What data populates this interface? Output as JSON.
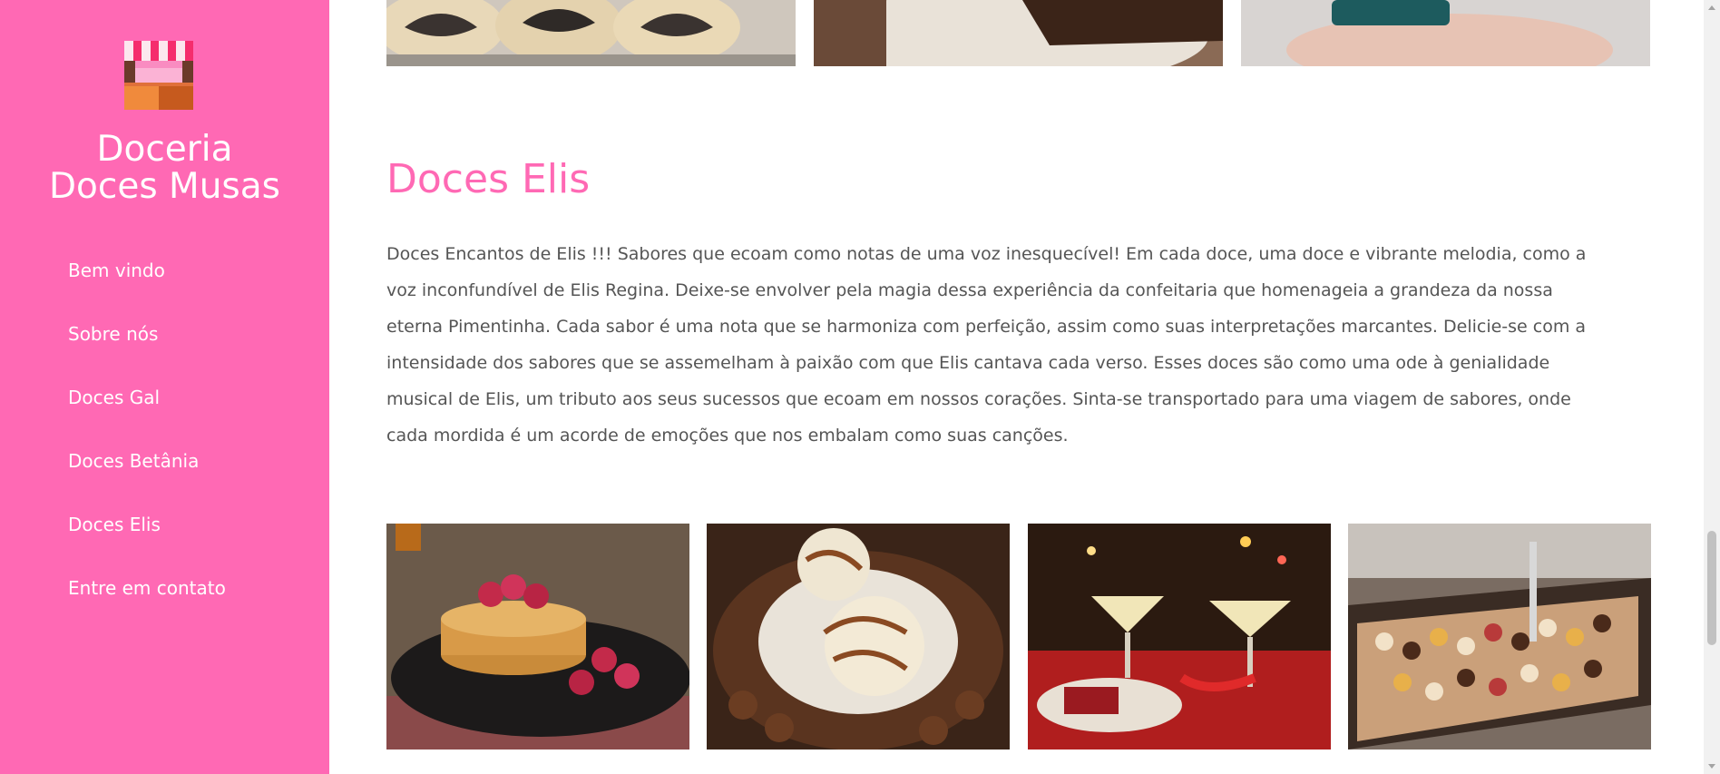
{
  "brand": {
    "title_line1": "Doceria",
    "title_line2": "Doces Musas",
    "logo_icon": "shop-awning-icon",
    "accent_color": "#ff69b4"
  },
  "nav": {
    "items": [
      {
        "label": "Bem vindo"
      },
      {
        "label": "Sobre nós"
      },
      {
        "label": "Doces Gal"
      },
      {
        "label": "Doces Betânia"
      },
      {
        "label": "Doces Elis"
      },
      {
        "label": "Entre em contato"
      }
    ]
  },
  "section": {
    "title": "Doces Elis",
    "text": "Doces Encantos de Elis !!! Sabores que ecoam como notas de uma voz inesquecível! Em cada doce, uma doce e vibrante melodia, como a voz inconfundível de Elis Regina. Deixe-se envolver pela magia dessa experiência da confeitaria que homenageia a grandeza da nossa eterna Pimentinha. Cada sabor é uma nota que se harmoniza com perfeição, assim como suas interpretações marcantes. Delicie-se com a intensidade dos sabores que se assemelham à paixão com que Elis cantava cada verso. Esses doces são como uma ode à genialidade musical de Elis, um tributo aos seus sucessos que ecoam em nossos corações. Sinta-se transportado para uma viagem de sabores, onde cada mordida é um acorde de emoções que nos embalam como suas canções."
  },
  "images": {
    "top_row": [
      "poppy-seed-roll-photo",
      "chocolate-cake-slice-photo",
      "cupcake-in-hand-photo"
    ],
    "bottom_row": [
      "pancakes-raspberries-photo",
      "coconut-chocolate-dessert-photo",
      "christmas-cocktails-photo",
      "pastry-display-case-photo"
    ]
  }
}
